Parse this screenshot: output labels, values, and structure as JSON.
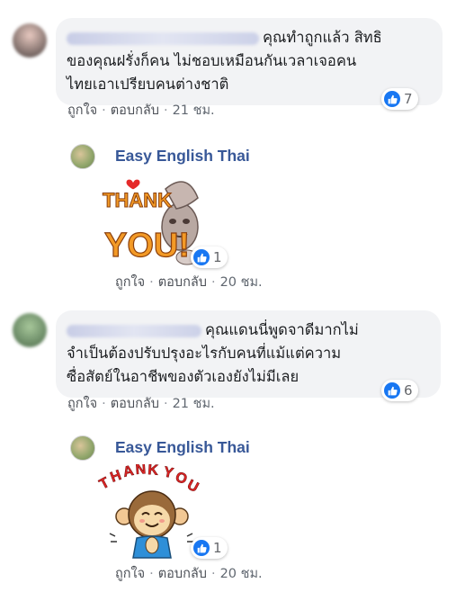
{
  "comments": [
    {
      "text_line1": "คุณทำถูกแล้ว สิทธิ",
      "text_line2": "ของคุณฝรั่งก็คน ไม่ชอบเหมือนกันเวลาเจอคน",
      "text_line3": "ไทยเอาเปรียบคนต่างชาติ",
      "likes": "7",
      "like_label": "ถูกใจ",
      "reply_label": "ตอบกลับ",
      "time": "21 ชม."
    },
    {
      "page_name": "Easy English Thai",
      "sticker_text": "THANK YOU!",
      "likes": "1",
      "like_label": "ถูกใจ",
      "reply_label": "ตอบกลับ",
      "time": "20 ชม."
    },
    {
      "text_line1": "คุณแดนนี่พูดจาดีมากไม่",
      "text_line2": "จำเป็นต้องปรับปรุงอะไรกับคนที่แม้แต่ความ",
      "text_line3": "ซื่อสัตย์ในอาชีพของตัวเองยังไม่มีเลย",
      "likes": "6",
      "like_label": "ถูกใจ",
      "reply_label": "ตอบกลับ",
      "time": "21 ชม."
    },
    {
      "page_name": "Easy English Thai",
      "sticker_text": "THANK YOU",
      "likes": "1",
      "like_label": "ถูกใจ",
      "reply_label": "ตอบกลับ",
      "time": "20 ชม."
    }
  ],
  "separator": "·",
  "colors": {
    "like_blue": "#1877f2",
    "page_name": "#385898",
    "bubble": "#f2f3f5"
  }
}
